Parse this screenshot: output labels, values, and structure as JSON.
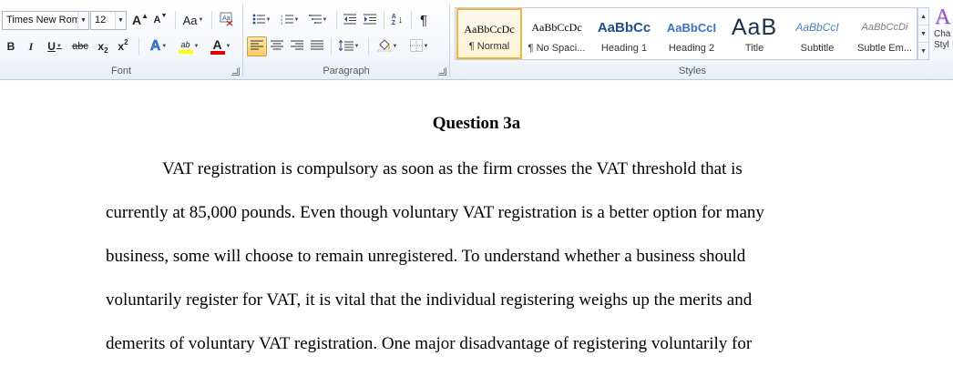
{
  "font_group": {
    "label": "Font",
    "font_name": "Times New Rom",
    "font_size": "12",
    "grow_font_label": "A",
    "shrink_font_label": "A",
    "change_case_label": "Aa",
    "bold_label": "B",
    "italic_label": "I",
    "underline_label": "U",
    "strikethrough_label": "abc",
    "subscript_label": "x",
    "superscript_label": "x",
    "text_effects_label": "A",
    "highlight_label": "ab",
    "font_color_label": "A",
    "highlight_color": "#ffff00",
    "font_color": "#e00000"
  },
  "paragraph_group": {
    "label": "Paragraph",
    "sort_label": "A Z",
    "pilcrow_label": "¶"
  },
  "styles_group": {
    "label": "Styles",
    "items": [
      {
        "preview": "AaBbCcDc",
        "name": "¶ Normal"
      },
      {
        "preview": "AaBbCcDc",
        "name": "¶ No Spaci..."
      },
      {
        "preview": "AaBbCc",
        "name": "Heading 1"
      },
      {
        "preview": "AaBbCcI",
        "name": "Heading 2"
      },
      {
        "preview": "AaB",
        "name": "Title"
      },
      {
        "preview": "AaBbCcI",
        "name": "Subtitle"
      },
      {
        "preview": "AaBbCcDi",
        "name": "Subtle Em..."
      }
    ],
    "change_styles_label": "Cha\nStyl",
    "change_styles_icon_label": "A"
  },
  "document": {
    "title": "Question 3a",
    "lines": [
      "VAT registration is compulsory as soon as the firm crosses the VAT threshold that is",
      "currently at 85,000 pounds. Even though voluntary VAT registration is a better option for many",
      "business, some will choose to remain unregistered. To understand whether a business should",
      "voluntarily register for VAT, it is vital that the individual registering weighs up the merits and",
      "demerits of voluntary VAT registration. One major disadvantage of registering voluntarily for"
    ]
  }
}
